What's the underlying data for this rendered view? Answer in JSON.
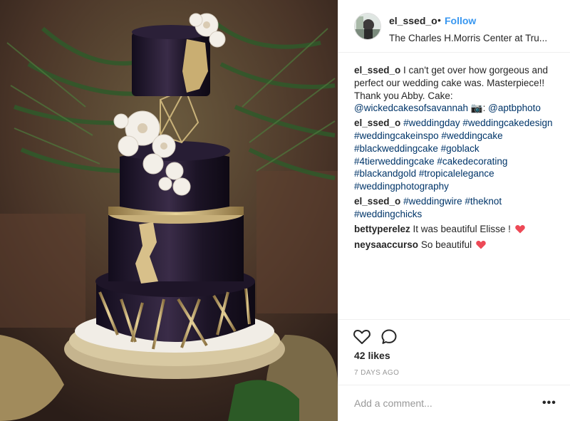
{
  "header": {
    "username": "el_ssed_o",
    "separator": "•",
    "follow_label": "Follow",
    "location": "The Charles H.Morris Center at Tru..."
  },
  "comments": [
    {
      "user": "el_ssed_o",
      "text": " I can't get over how gorgeous and perfect our wedding cake was. Masterpiece!! Thank you Abby. Cake: ",
      "mention": "@wickedcakesofsavannah",
      "camera": " 📷: ",
      "mention2": "@aptbphoto"
    },
    {
      "user": "el_ssed_o",
      "text": " ",
      "tags": "#weddingday #weddingcakedesign #weddingcakeinspo #weddingcake #blackweddingcake #goblack #4tierweddingcake #cakedecorating #blackandgold #tropicalelegance #weddingphotography"
    },
    {
      "user": "el_ssed_o",
      "text": " ",
      "tags": "#weddingwire #theknot #weddingchicks"
    },
    {
      "user": "bettyperelez",
      "text": " It was beautiful Elisse ! "
    },
    {
      "user": "neysaaccurso",
      "text": " So beautiful "
    }
  ],
  "actions": {
    "like_icon": "heart-outline-icon",
    "comment_icon": "comment-bubble-icon",
    "likes": "42 likes",
    "time": "7 DAYS AGO"
  },
  "add_comment": {
    "placeholder": "Add a comment...",
    "more_label": "•••"
  },
  "colors": {
    "accent": "#3897f0",
    "hashtag": "#003569",
    "heart": "#ed4956",
    "muted": "#999999"
  }
}
